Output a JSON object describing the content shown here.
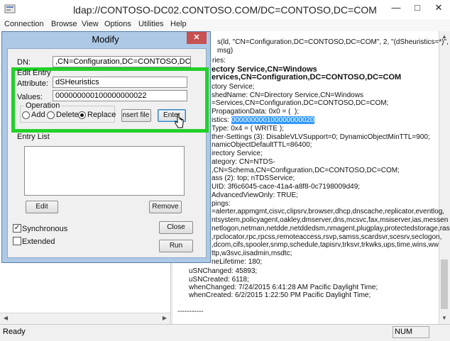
{
  "window": {
    "title": "ldap://CONTOSO-DC02.CONTOSO.COM/DC=CONTOSO,DC=COM"
  },
  "menu": [
    "Connection",
    "Browse",
    "View",
    "Options",
    "Utilities",
    "Help"
  ],
  "output": {
    "lines": [
      "s(ld, \"CN=Configuration,DC=CONTOSO,DC=COM\", 2, \"(dSheuristics=*)\",",
      "msg)",
      "ries:",
      "ectory Service,CN=Windows",
      "ervices,CN=Configuration,DC=CONTOSO,DC=COM",
      "ctory Service;",
      "shedName: CN=Directory Service,CN=Windows",
      "=Services,CN=Configuration,DC=CONTOSO,DC=COM;",
      "PropagationData: 0x0 = (  );"
    ],
    "heuristics_prefix": "istics: ",
    "heuristics_value": "000000000100000000020",
    "lines2": [
      "Type: 0x4 = ( WRITE );",
      "ther-Settings (3): DisableVLVSupport=0; DynamicObjectMinTTL=900;",
      "namicObjectDefaultTTL=86400;",
      "irectory Service;",
      "ategory: CN=NTDS-",
      ",CN=Schema,CN=Configuration,DC=CONTOSO,DC=COM;",
      "ass (2): top; nTDSService;",
      "UID: 3f6c6045-cace-41a4-a8f8-0c7198009d49;",
      "AdvancedViewOnly: TRUE;",
      "pings:",
      "=alerter,appmgmt,cisvc,clipsrv,browser,dhcp,dnscache,replicator,eventlog,",
      "ntsystem,policyagent,oakley,dmserver,dns,mcsvc,fax,msiserver,ias,messen",
      "netlogon,netman,netdde,netddedsm,nmagent,plugplay,protectedstorage,ras",
      ",rpclocator,rpc,rpcss,remoteaccess,rsvp,samss,scardsvr,scesrv,seclogon,",
      ",dcom,cifs,spooler,snmp,schedule,tapisrv,trksvr,trkwks,ups,time,wins,ww",
      "ttp,w3svc,iisadmin,msdtc;",
      "neLifetime: 180;"
    ],
    "tail": [
      "uSNChanged: 45893;",
      "uSNCreated: 6118;",
      "whenChanged: 7/24/2015 6:41:28 AM Pacific Daylight Time;",
      "whenCreated: 6/2/2015 1:22:50 PM Pacific Daylight Time;",
      "-----------"
    ]
  },
  "status": {
    "ready": "Ready",
    "num": "NUM"
  },
  "dialog": {
    "title": "Modify",
    "close_glyph": "✕",
    "dn_label": "DN:",
    "dn_value": ",CN=Configuration,DC=CONTOSO,DC=COM",
    "edit_entry_label": "Edit Entry",
    "attribute_label": "Attribute:",
    "attribute_value": "dSHeuristics",
    "values_label": "Values:",
    "values_value": "000000000100000000022",
    "operation_label": "Operation",
    "op_add": "Add",
    "op_delete": "Delete",
    "op_replace": "Replace",
    "insert_file": "Insert file",
    "enter": "Enter",
    "entry_list_label": "Entry List",
    "edit": "Edit",
    "remove": "Remove",
    "synchronous": "Synchronous",
    "extended": "Extended",
    "close": "Close",
    "run": "Run"
  },
  "colors": {
    "highlight_box": "#22d12a",
    "selection": "#3399ff",
    "dialog_frame": "#aec9e6"
  }
}
